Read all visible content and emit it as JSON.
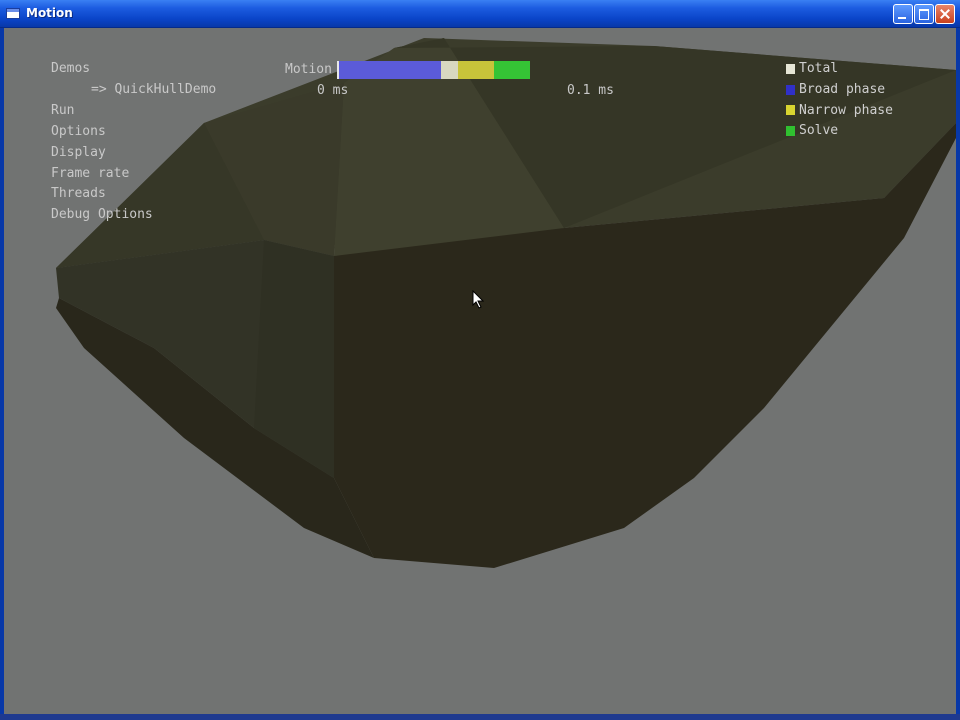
{
  "window": {
    "title": "Motion"
  },
  "menu": {
    "items": [
      {
        "label": "Demos"
      },
      {
        "label": "=> QuickHullDemo"
      },
      {
        "label": "Run"
      },
      {
        "label": "Options"
      },
      {
        "label": "Display"
      },
      {
        "label": "Frame rate"
      },
      {
        "label": "Threads"
      },
      {
        "label": "Debug Options"
      }
    ]
  },
  "profiler": {
    "label": "Motion",
    "scale_min_label": "0 ms",
    "scale_max_label": "0.1 ms",
    "segments": [
      {
        "name": "Broad phase",
        "color": "#5b5bd8",
        "fraction": 0.53
      },
      {
        "name": "Total",
        "color": "#d8d8c0",
        "fraction": 0.09
      },
      {
        "name": "Narrow phase",
        "color": "#c8c43a",
        "fraction": 0.19
      },
      {
        "name": "Solve",
        "color": "#35c435",
        "fraction": 0.19
      }
    ]
  },
  "legend": {
    "items": [
      {
        "label": "Total",
        "color": "#e6e6d6"
      },
      {
        "label": "Broad phase",
        "color": "#3030c8"
      },
      {
        "label": "Narrow phase",
        "color": "#d8d430"
      },
      {
        "label": "Solve",
        "color": "#30c030"
      }
    ]
  },
  "colors": {
    "background": "#717372",
    "hull_dark": "#2a261a",
    "hull_face": "#3a3a28",
    "titlebar": "#0a44c8"
  }
}
